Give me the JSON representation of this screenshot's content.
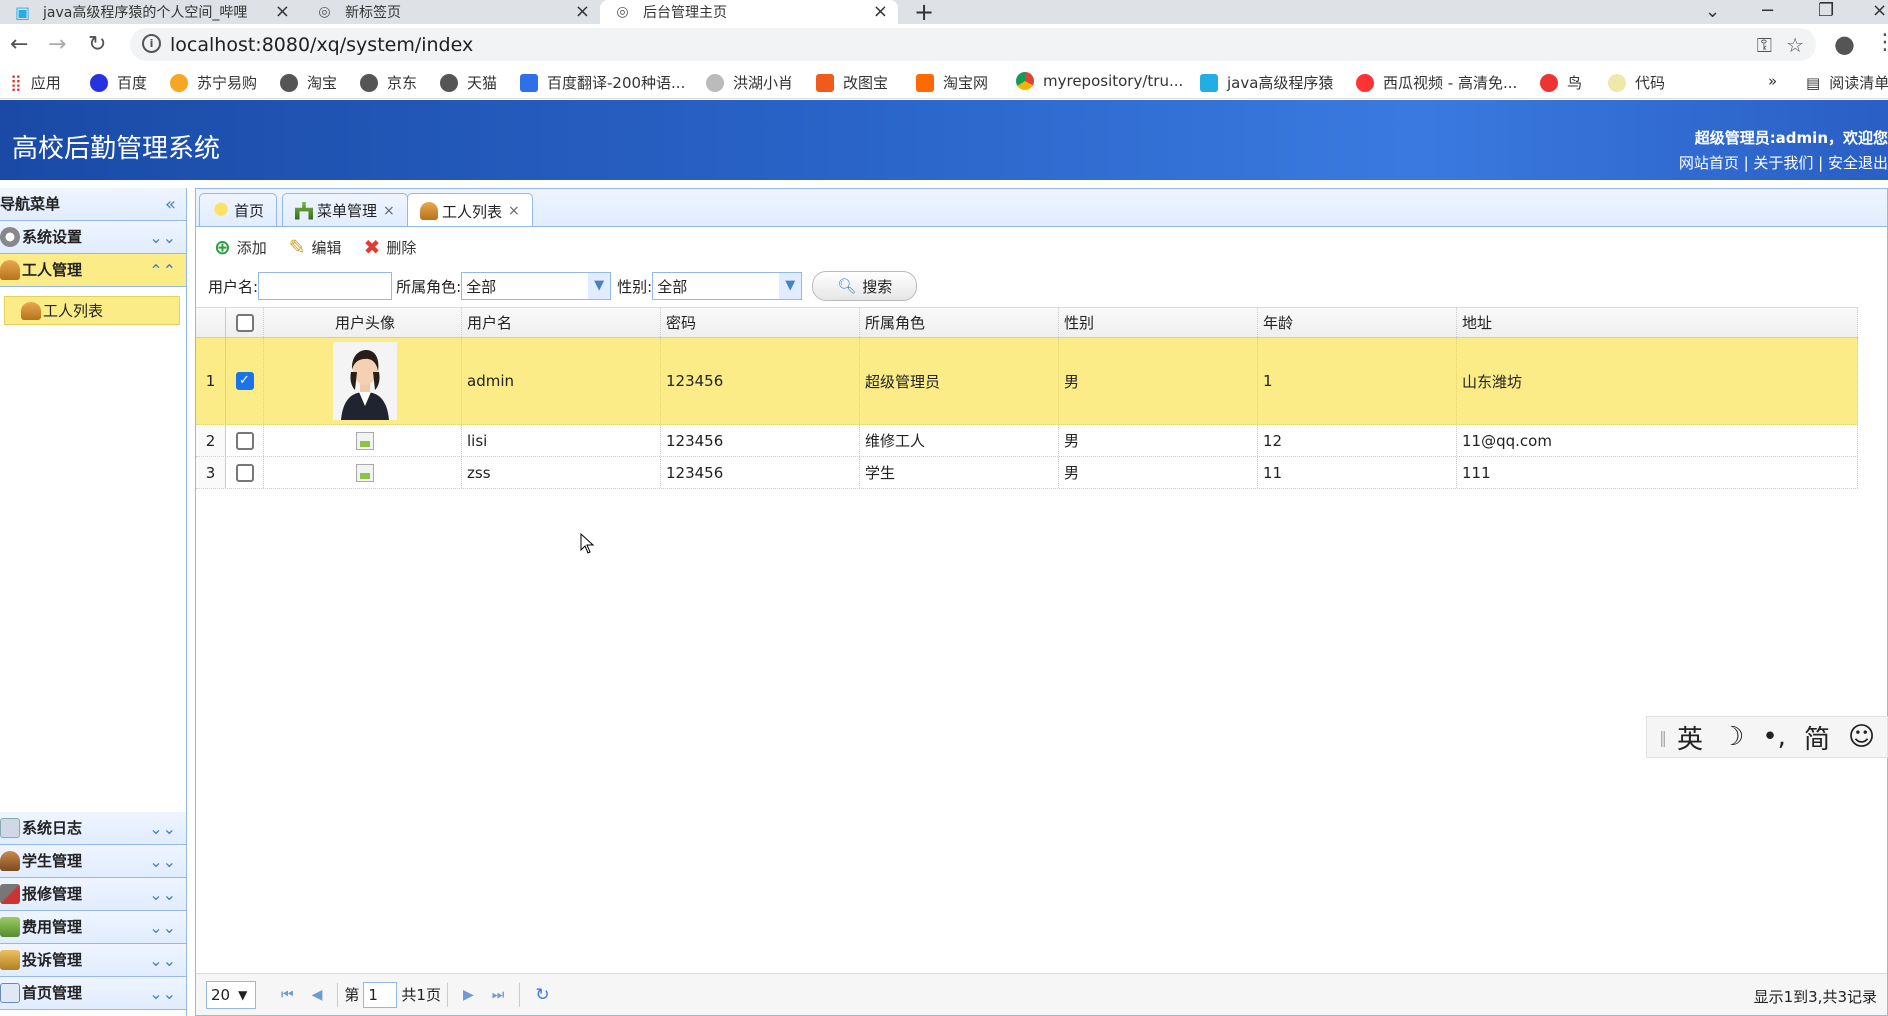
{
  "browser": {
    "tabs": [
      {
        "title": "java高级程序猿的个人空间_哔哩",
        "active": false
      },
      {
        "title": "新标签页",
        "active": false
      },
      {
        "title": "后台管理主页",
        "active": true
      }
    ],
    "url": "localhost:8080/xq/system/index",
    "bookmarks": [
      "应用",
      "百度",
      "苏宁易购",
      "淘宝",
      "京东",
      "天猫",
      "百度翻译-200种语...",
      "洪湖小肖",
      "改图宝",
      "淘宝网",
      "myrepository/tru...",
      "java高级程序猿",
      "西瓜视频 - 高清免...",
      "鸟",
      "代码"
    ],
    "bookmarks_more": "»",
    "reading_list": "阅读清单"
  },
  "app": {
    "title": "高校后勤管理系统",
    "user_greeting": "超级管理员:admin，欢迎您",
    "links": "网站首页 | 关于我们 | 安全退出"
  },
  "sidebar": {
    "header": "导航菜单",
    "panels_top": [
      {
        "label": "系统设置",
        "open": false
      },
      {
        "label": "工人管理",
        "open": true
      }
    ],
    "open_item": "工人列表",
    "panels_bottom": [
      "系统日志",
      "学生管理",
      "报修管理",
      "费用管理",
      "投诉管理",
      "首页管理"
    ]
  },
  "content_tabs": [
    {
      "label": "首页",
      "closable": false,
      "active": false
    },
    {
      "label": "菜单管理",
      "closable": true,
      "active": false
    },
    {
      "label": "工人列表",
      "closable": true,
      "active": true
    }
  ],
  "toolbar": {
    "add": "添加",
    "edit": "编辑",
    "delete": "删除"
  },
  "search": {
    "username_label": "用户名:",
    "username_value": "",
    "role_label": "所属角色:",
    "role_value": "全部",
    "gender_label": "性别:",
    "gender_value": "全部",
    "search_button": "搜索"
  },
  "grid": {
    "columns": [
      "用户头像",
      "用户名",
      "密码",
      "所属角色",
      "性别",
      "年龄",
      "地址"
    ],
    "rows": [
      {
        "num": "1",
        "checked": true,
        "avatar": "photo",
        "username": "admin",
        "password": "123456",
        "role": "超级管理员",
        "gender": "男",
        "age": "1",
        "address": "山东潍坊"
      },
      {
        "num": "2",
        "checked": false,
        "avatar": "broken",
        "username": "lisi",
        "password": "123456",
        "role": "维修工人",
        "gender": "男",
        "age": "12",
        "address": "11@qq.com"
      },
      {
        "num": "3",
        "checked": false,
        "avatar": "broken",
        "username": "zss",
        "password": "123456",
        "role": "学生",
        "gender": "男",
        "age": "11",
        "address": "111"
      }
    ]
  },
  "pager": {
    "page_size": "20",
    "page_prefix": "第",
    "page_value": "1",
    "page_total": "共1页",
    "info": "显示1到3,共3记录"
  },
  "ime": [
    "英",
    "☽",
    "•,",
    "简",
    "☺",
    "⚙"
  ]
}
